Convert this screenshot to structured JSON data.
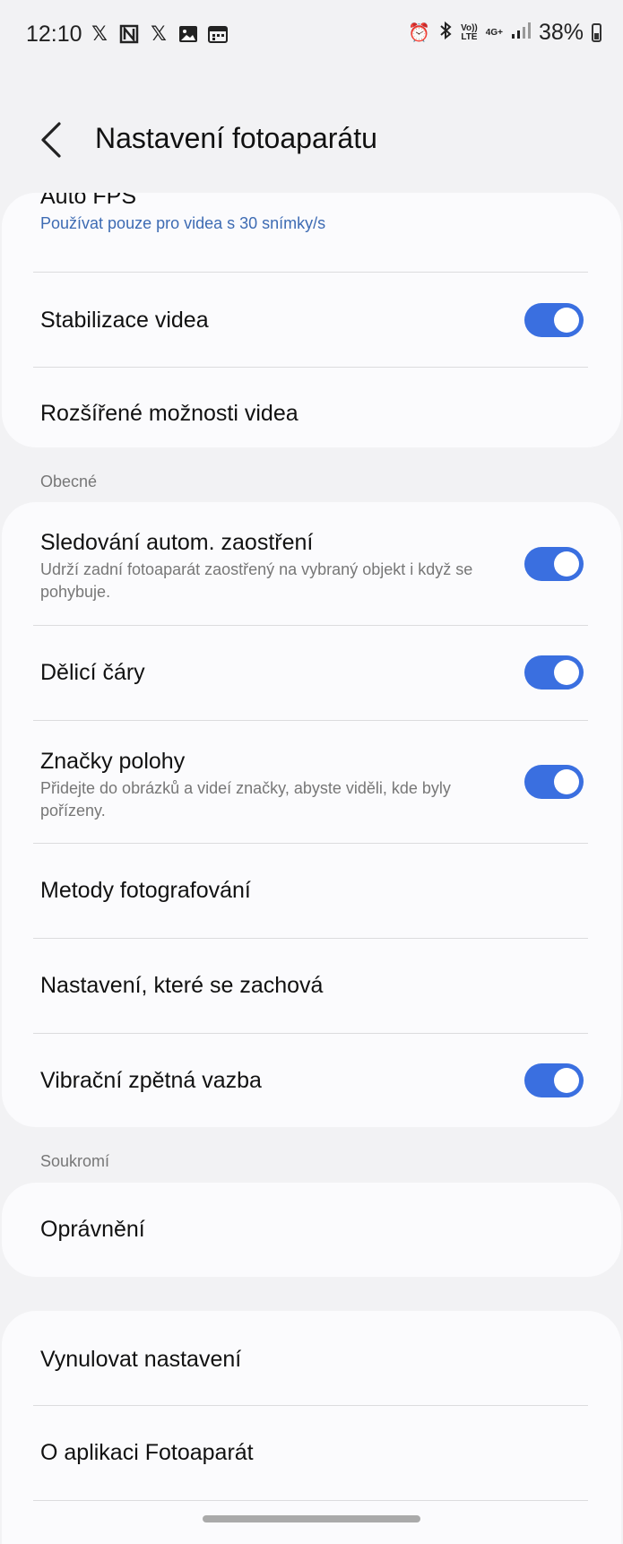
{
  "status_bar": {
    "time": "12:10",
    "left_icons": [
      "x-icon",
      "n-icon",
      "x-icon",
      "image-icon",
      "calendar-icon"
    ],
    "network_volte": "Vo))\nLTE",
    "network_4g": "4G+",
    "battery_percent": "38%"
  },
  "header": {
    "title": "Nastavení fotoaparátu"
  },
  "card_video": {
    "auto_fps": {
      "label": "Auto FPS",
      "sub": "Používat pouze pro videa s 30 snímky/s"
    },
    "stabilization": {
      "label": "Stabilizace videa",
      "on": true
    },
    "advanced": {
      "label": "Rozšířené možnosti videa"
    }
  },
  "section_general": {
    "title": "Obecné"
  },
  "card_general": {
    "tracking_af": {
      "label": "Sledování autom. zaostření",
      "sub": "Udrží zadní fotoaparát zaostřený na vybraný objekt i když se pohybuje.",
      "on": true
    },
    "grid_lines": {
      "label": "Dělicí čáry",
      "on": true
    },
    "location_tags": {
      "label": "Značky polohy",
      "sub": "Přidejte do obrázků a videí značky, abyste viděli, kde byly pořízeny.",
      "on": true
    },
    "shooting_methods": {
      "label": "Metody fotografování"
    },
    "settings_to_keep": {
      "label": "Nastavení, které se zachová"
    },
    "vibration": {
      "label": "Vibrační zpětná vazba",
      "on": true
    }
  },
  "section_privacy": {
    "title": "Soukromí"
  },
  "card_privacy": {
    "permissions": {
      "label": "Oprávnění"
    }
  },
  "card_misc": {
    "reset": {
      "label": "Vynulovat nastavení"
    },
    "about": {
      "label": "O aplikaci Fotoaparát"
    }
  },
  "colors": {
    "accent": "#3a6fe0",
    "link": "#3d6bb3",
    "background": "#f2f2f4",
    "card": "#fbfbfd"
  }
}
